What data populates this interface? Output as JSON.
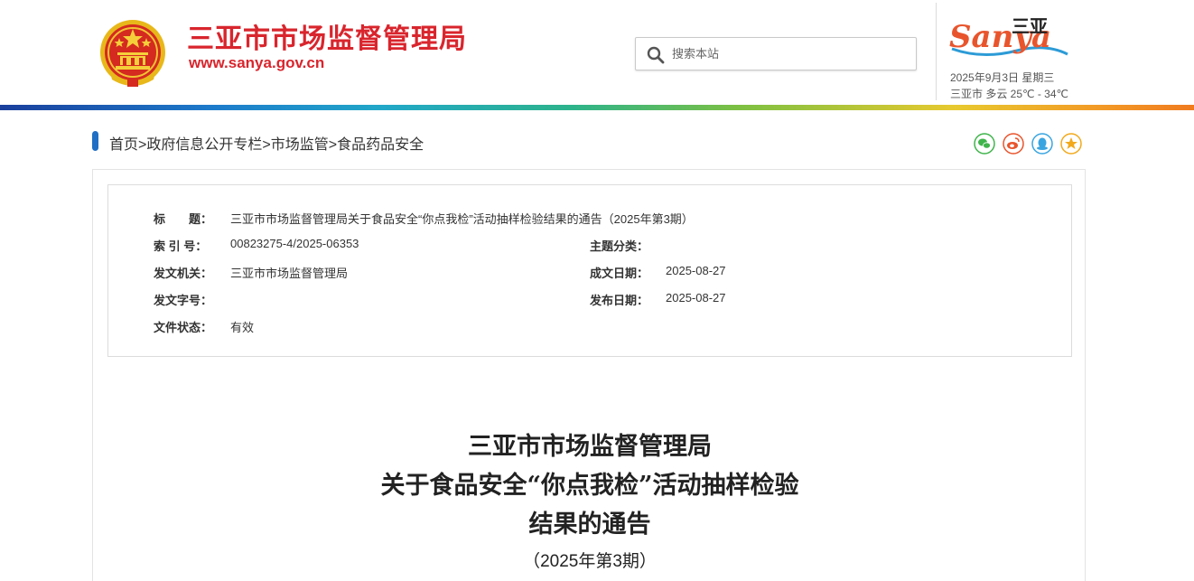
{
  "header": {
    "site_title": "三亚市市场监督管理局",
    "site_url": "www.sanya.gov.cn",
    "search_placeholder": "搜索本站",
    "logo_text": "Sanya",
    "logo_cn": "三亚",
    "date": "2025年9月3日 星期三",
    "weather": "三亚市 多云 25℃ - 34℃"
  },
  "breadcrumb": {
    "items": [
      "首页",
      "政府信息公开专栏",
      "市场监管",
      "食品药品安全"
    ],
    "separator": ">"
  },
  "share": {
    "icons": [
      "wechat-icon",
      "weibo-icon",
      "qq-icon",
      "favorite-icon"
    ],
    "colors": {
      "wechat": "#3fb44b",
      "weibo": "#e8552d",
      "qq": "#39a5e0",
      "favorite": "#f2a91c"
    }
  },
  "meta": {
    "title_label": "标　　题：",
    "title_value": "三亚市市场监督管理局关于食品安全“你点我检”活动抽样检验结果的通告（2025年第3期）",
    "index_label": "索 引 号：",
    "index_value": "00823275-4/2025-06353",
    "topic_label": "主题分类：",
    "topic_value": "",
    "issuer_label": "发文机关：",
    "issuer_value": "三亚市市场监督管理局",
    "created_label": "成文日期：",
    "created_value": "2025-08-27",
    "docno_label": "发文字号：",
    "docno_value": "",
    "published_label": "发布日期：",
    "published_value": "2025-08-27",
    "status_label": "文件状态：",
    "status_value": "有效"
  },
  "document": {
    "title_line1": "三亚市市场监督管理局",
    "title_line2": "关于食品安全“你点我检”活动抽样检验",
    "title_line3": "结果的通告",
    "subtitle": "（2025年第3期）"
  },
  "colors": {
    "brand_red": "#d9252d",
    "accent_blue": "#1f6fc4"
  }
}
